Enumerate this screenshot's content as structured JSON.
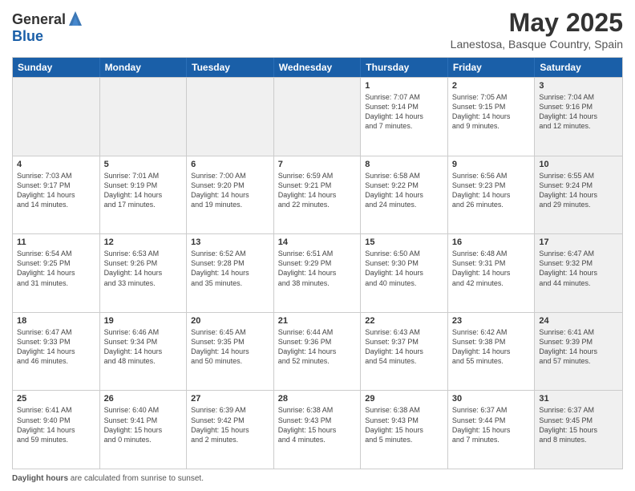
{
  "logo": {
    "general": "General",
    "blue": "Blue"
  },
  "title": "May 2025",
  "subtitle": "Lanestosa, Basque Country, Spain",
  "header_days": [
    "Sunday",
    "Monday",
    "Tuesday",
    "Wednesday",
    "Thursday",
    "Friday",
    "Saturday"
  ],
  "rows": [
    [
      {
        "num": "",
        "lines": [],
        "shaded": true
      },
      {
        "num": "",
        "lines": [],
        "shaded": true
      },
      {
        "num": "",
        "lines": [],
        "shaded": true
      },
      {
        "num": "",
        "lines": [],
        "shaded": true
      },
      {
        "num": "1",
        "lines": [
          "Sunrise: 7:07 AM",
          "Sunset: 9:14 PM",
          "Daylight: 14 hours",
          "and 7 minutes."
        ],
        "shaded": false
      },
      {
        "num": "2",
        "lines": [
          "Sunrise: 7:05 AM",
          "Sunset: 9:15 PM",
          "Daylight: 14 hours",
          "and 9 minutes."
        ],
        "shaded": false
      },
      {
        "num": "3",
        "lines": [
          "Sunrise: 7:04 AM",
          "Sunset: 9:16 PM",
          "Daylight: 14 hours",
          "and 12 minutes."
        ],
        "shaded": true
      }
    ],
    [
      {
        "num": "4",
        "lines": [
          "Sunrise: 7:03 AM",
          "Sunset: 9:17 PM",
          "Daylight: 14 hours",
          "and 14 minutes."
        ],
        "shaded": false
      },
      {
        "num": "5",
        "lines": [
          "Sunrise: 7:01 AM",
          "Sunset: 9:19 PM",
          "Daylight: 14 hours",
          "and 17 minutes."
        ],
        "shaded": false
      },
      {
        "num": "6",
        "lines": [
          "Sunrise: 7:00 AM",
          "Sunset: 9:20 PM",
          "Daylight: 14 hours",
          "and 19 minutes."
        ],
        "shaded": false
      },
      {
        "num": "7",
        "lines": [
          "Sunrise: 6:59 AM",
          "Sunset: 9:21 PM",
          "Daylight: 14 hours",
          "and 22 minutes."
        ],
        "shaded": false
      },
      {
        "num": "8",
        "lines": [
          "Sunrise: 6:58 AM",
          "Sunset: 9:22 PM",
          "Daylight: 14 hours",
          "and 24 minutes."
        ],
        "shaded": false
      },
      {
        "num": "9",
        "lines": [
          "Sunrise: 6:56 AM",
          "Sunset: 9:23 PM",
          "Daylight: 14 hours",
          "and 26 minutes."
        ],
        "shaded": false
      },
      {
        "num": "10",
        "lines": [
          "Sunrise: 6:55 AM",
          "Sunset: 9:24 PM",
          "Daylight: 14 hours",
          "and 29 minutes."
        ],
        "shaded": true
      }
    ],
    [
      {
        "num": "11",
        "lines": [
          "Sunrise: 6:54 AM",
          "Sunset: 9:25 PM",
          "Daylight: 14 hours",
          "and 31 minutes."
        ],
        "shaded": false
      },
      {
        "num": "12",
        "lines": [
          "Sunrise: 6:53 AM",
          "Sunset: 9:26 PM",
          "Daylight: 14 hours",
          "and 33 minutes."
        ],
        "shaded": false
      },
      {
        "num": "13",
        "lines": [
          "Sunrise: 6:52 AM",
          "Sunset: 9:28 PM",
          "Daylight: 14 hours",
          "and 35 minutes."
        ],
        "shaded": false
      },
      {
        "num": "14",
        "lines": [
          "Sunrise: 6:51 AM",
          "Sunset: 9:29 PM",
          "Daylight: 14 hours",
          "and 38 minutes."
        ],
        "shaded": false
      },
      {
        "num": "15",
        "lines": [
          "Sunrise: 6:50 AM",
          "Sunset: 9:30 PM",
          "Daylight: 14 hours",
          "and 40 minutes."
        ],
        "shaded": false
      },
      {
        "num": "16",
        "lines": [
          "Sunrise: 6:48 AM",
          "Sunset: 9:31 PM",
          "Daylight: 14 hours",
          "and 42 minutes."
        ],
        "shaded": false
      },
      {
        "num": "17",
        "lines": [
          "Sunrise: 6:47 AM",
          "Sunset: 9:32 PM",
          "Daylight: 14 hours",
          "and 44 minutes."
        ],
        "shaded": true
      }
    ],
    [
      {
        "num": "18",
        "lines": [
          "Sunrise: 6:47 AM",
          "Sunset: 9:33 PM",
          "Daylight: 14 hours",
          "and 46 minutes."
        ],
        "shaded": false
      },
      {
        "num": "19",
        "lines": [
          "Sunrise: 6:46 AM",
          "Sunset: 9:34 PM",
          "Daylight: 14 hours",
          "and 48 minutes."
        ],
        "shaded": false
      },
      {
        "num": "20",
        "lines": [
          "Sunrise: 6:45 AM",
          "Sunset: 9:35 PM",
          "Daylight: 14 hours",
          "and 50 minutes."
        ],
        "shaded": false
      },
      {
        "num": "21",
        "lines": [
          "Sunrise: 6:44 AM",
          "Sunset: 9:36 PM",
          "Daylight: 14 hours",
          "and 52 minutes."
        ],
        "shaded": false
      },
      {
        "num": "22",
        "lines": [
          "Sunrise: 6:43 AM",
          "Sunset: 9:37 PM",
          "Daylight: 14 hours",
          "and 54 minutes."
        ],
        "shaded": false
      },
      {
        "num": "23",
        "lines": [
          "Sunrise: 6:42 AM",
          "Sunset: 9:38 PM",
          "Daylight: 14 hours",
          "and 55 minutes."
        ],
        "shaded": false
      },
      {
        "num": "24",
        "lines": [
          "Sunrise: 6:41 AM",
          "Sunset: 9:39 PM",
          "Daylight: 14 hours",
          "and 57 minutes."
        ],
        "shaded": true
      }
    ],
    [
      {
        "num": "25",
        "lines": [
          "Sunrise: 6:41 AM",
          "Sunset: 9:40 PM",
          "Daylight: 14 hours",
          "and 59 minutes."
        ],
        "shaded": false
      },
      {
        "num": "26",
        "lines": [
          "Sunrise: 6:40 AM",
          "Sunset: 9:41 PM",
          "Daylight: 15 hours",
          "and 0 minutes."
        ],
        "shaded": false
      },
      {
        "num": "27",
        "lines": [
          "Sunrise: 6:39 AM",
          "Sunset: 9:42 PM",
          "Daylight: 15 hours",
          "and 2 minutes."
        ],
        "shaded": false
      },
      {
        "num": "28",
        "lines": [
          "Sunrise: 6:38 AM",
          "Sunset: 9:43 PM",
          "Daylight: 15 hours",
          "and 4 minutes."
        ],
        "shaded": false
      },
      {
        "num": "29",
        "lines": [
          "Sunrise: 6:38 AM",
          "Sunset: 9:43 PM",
          "Daylight: 15 hours",
          "and 5 minutes."
        ],
        "shaded": false
      },
      {
        "num": "30",
        "lines": [
          "Sunrise: 6:37 AM",
          "Sunset: 9:44 PM",
          "Daylight: 15 hours",
          "and 7 minutes."
        ],
        "shaded": false
      },
      {
        "num": "31",
        "lines": [
          "Sunrise: 6:37 AM",
          "Sunset: 9:45 PM",
          "Daylight: 15 hours",
          "and 8 minutes."
        ],
        "shaded": true
      }
    ]
  ],
  "footer": {
    "label": "Daylight hours",
    "text": " are calculated from sunrise to sunset."
  }
}
